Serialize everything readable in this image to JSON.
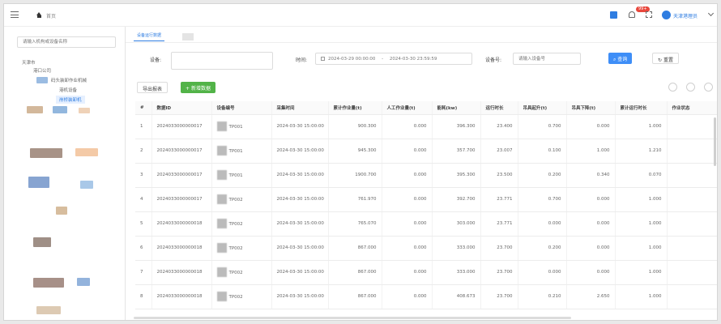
{
  "header": {
    "breadcrumb": "首页",
    "notification_count": "99+",
    "username": "天津港理员"
  },
  "sidebar": {
    "search_placeholder": "请输入机构或设备名称",
    "items": [
      {
        "label": "天津市"
      },
      {
        "label": "港口公司"
      },
      {
        "label": "码头装卸作业机械"
      },
      {
        "label": "港机设备"
      },
      {
        "label": "岸桥装卸机"
      }
    ]
  },
  "tabs": [
    {
      "label": "设备运行数据"
    }
  ],
  "filters": {
    "device_label": "设备:",
    "device_value": "",
    "time_label": "时间:",
    "time_start": "2024-03-29 00:00:00",
    "time_separator": "-",
    "time_end": "2024-03-30 23:59:59",
    "keyword_label": "设备号:",
    "keyword_placeholder": "请输入设备号",
    "search_button": "查询",
    "reset_button": "重置"
  },
  "actions": {
    "export_button": "导出报表",
    "add_button": "新增数据"
  },
  "table": {
    "columns": [
      "#",
      "数据ID",
      "设备编号",
      "采集时间",
      "累计作业量(t)",
      "人工作业量(t)",
      "能耗(kw)",
      "运行时长",
      "吊具起升(t)",
      "吊具下降(t)",
      "累计运行时长",
      "作业状态"
    ],
    "rows": [
      {
        "idx": "1",
        "id": "2024033000000017",
        "device": "TP001",
        "time": "2024-03-30 15:00:00",
        "c1": "900.300",
        "c2": "0.000",
        "c3": "396.300",
        "c4": "23.400",
        "c5": "0.700",
        "c6": "0.000",
        "c7": "1.000"
      },
      {
        "idx": "2",
        "id": "2024033000000017",
        "device": "TP001",
        "time": "2024-03-30 15:00:00",
        "c1": "945.300",
        "c2": "0.000",
        "c3": "357.700",
        "c4": "23.007",
        "c5": "0.100",
        "c6": "1.000",
        "c7": "1.210"
      },
      {
        "idx": "3",
        "id": "2024033000000017",
        "device": "TP001",
        "time": "2024-03-30 15:00:00",
        "c1": "1900.700",
        "c2": "0.000",
        "c3": "395.300",
        "c4": "23.500",
        "c5": "0.200",
        "c6": "0.340",
        "c7": "0.070"
      },
      {
        "idx": "4",
        "id": "2024033000000017",
        "device": "TP002",
        "time": "2024-03-30 15:00:00",
        "c1": "761.970",
        "c2": "0.000",
        "c3": "392.700",
        "c4": "23.771",
        "c5": "0.700",
        "c6": "0.000",
        "c7": "1.000"
      },
      {
        "idx": "5",
        "id": "2024033000000018",
        "device": "TP002",
        "time": "2024-03-30 15:00:00",
        "c1": "765.070",
        "c2": "0.000",
        "c3": "303.000",
        "c4": "23.771",
        "c5": "0.000",
        "c6": "0.000",
        "c7": "1.000"
      },
      {
        "idx": "6",
        "id": "2024033000000018",
        "device": "TP002",
        "time": "2024-03-30 15:00:00",
        "c1": "867.000",
        "c2": "0.000",
        "c3": "333.000",
        "c4": "23.700",
        "c5": "0.200",
        "c6": "0.000",
        "c7": "1.000"
      },
      {
        "idx": "7",
        "id": "2024033000000018",
        "device": "TP002",
        "time": "2024-03-30 15:00:00",
        "c1": "867.000",
        "c2": "0.000",
        "c3": "333.000",
        "c4": "23.700",
        "c5": "0.000",
        "c6": "0.000",
        "c7": "1.000"
      },
      {
        "idx": "8",
        "id": "2024033000000018",
        "device": "TP002",
        "time": "2024-03-30 15:00:00",
        "c1": "867.000",
        "c2": "0.000",
        "c3": "408.673",
        "c4": "23.700",
        "c5": "0.210",
        "c6": "2.650",
        "c7": "1.000"
      }
    ]
  }
}
